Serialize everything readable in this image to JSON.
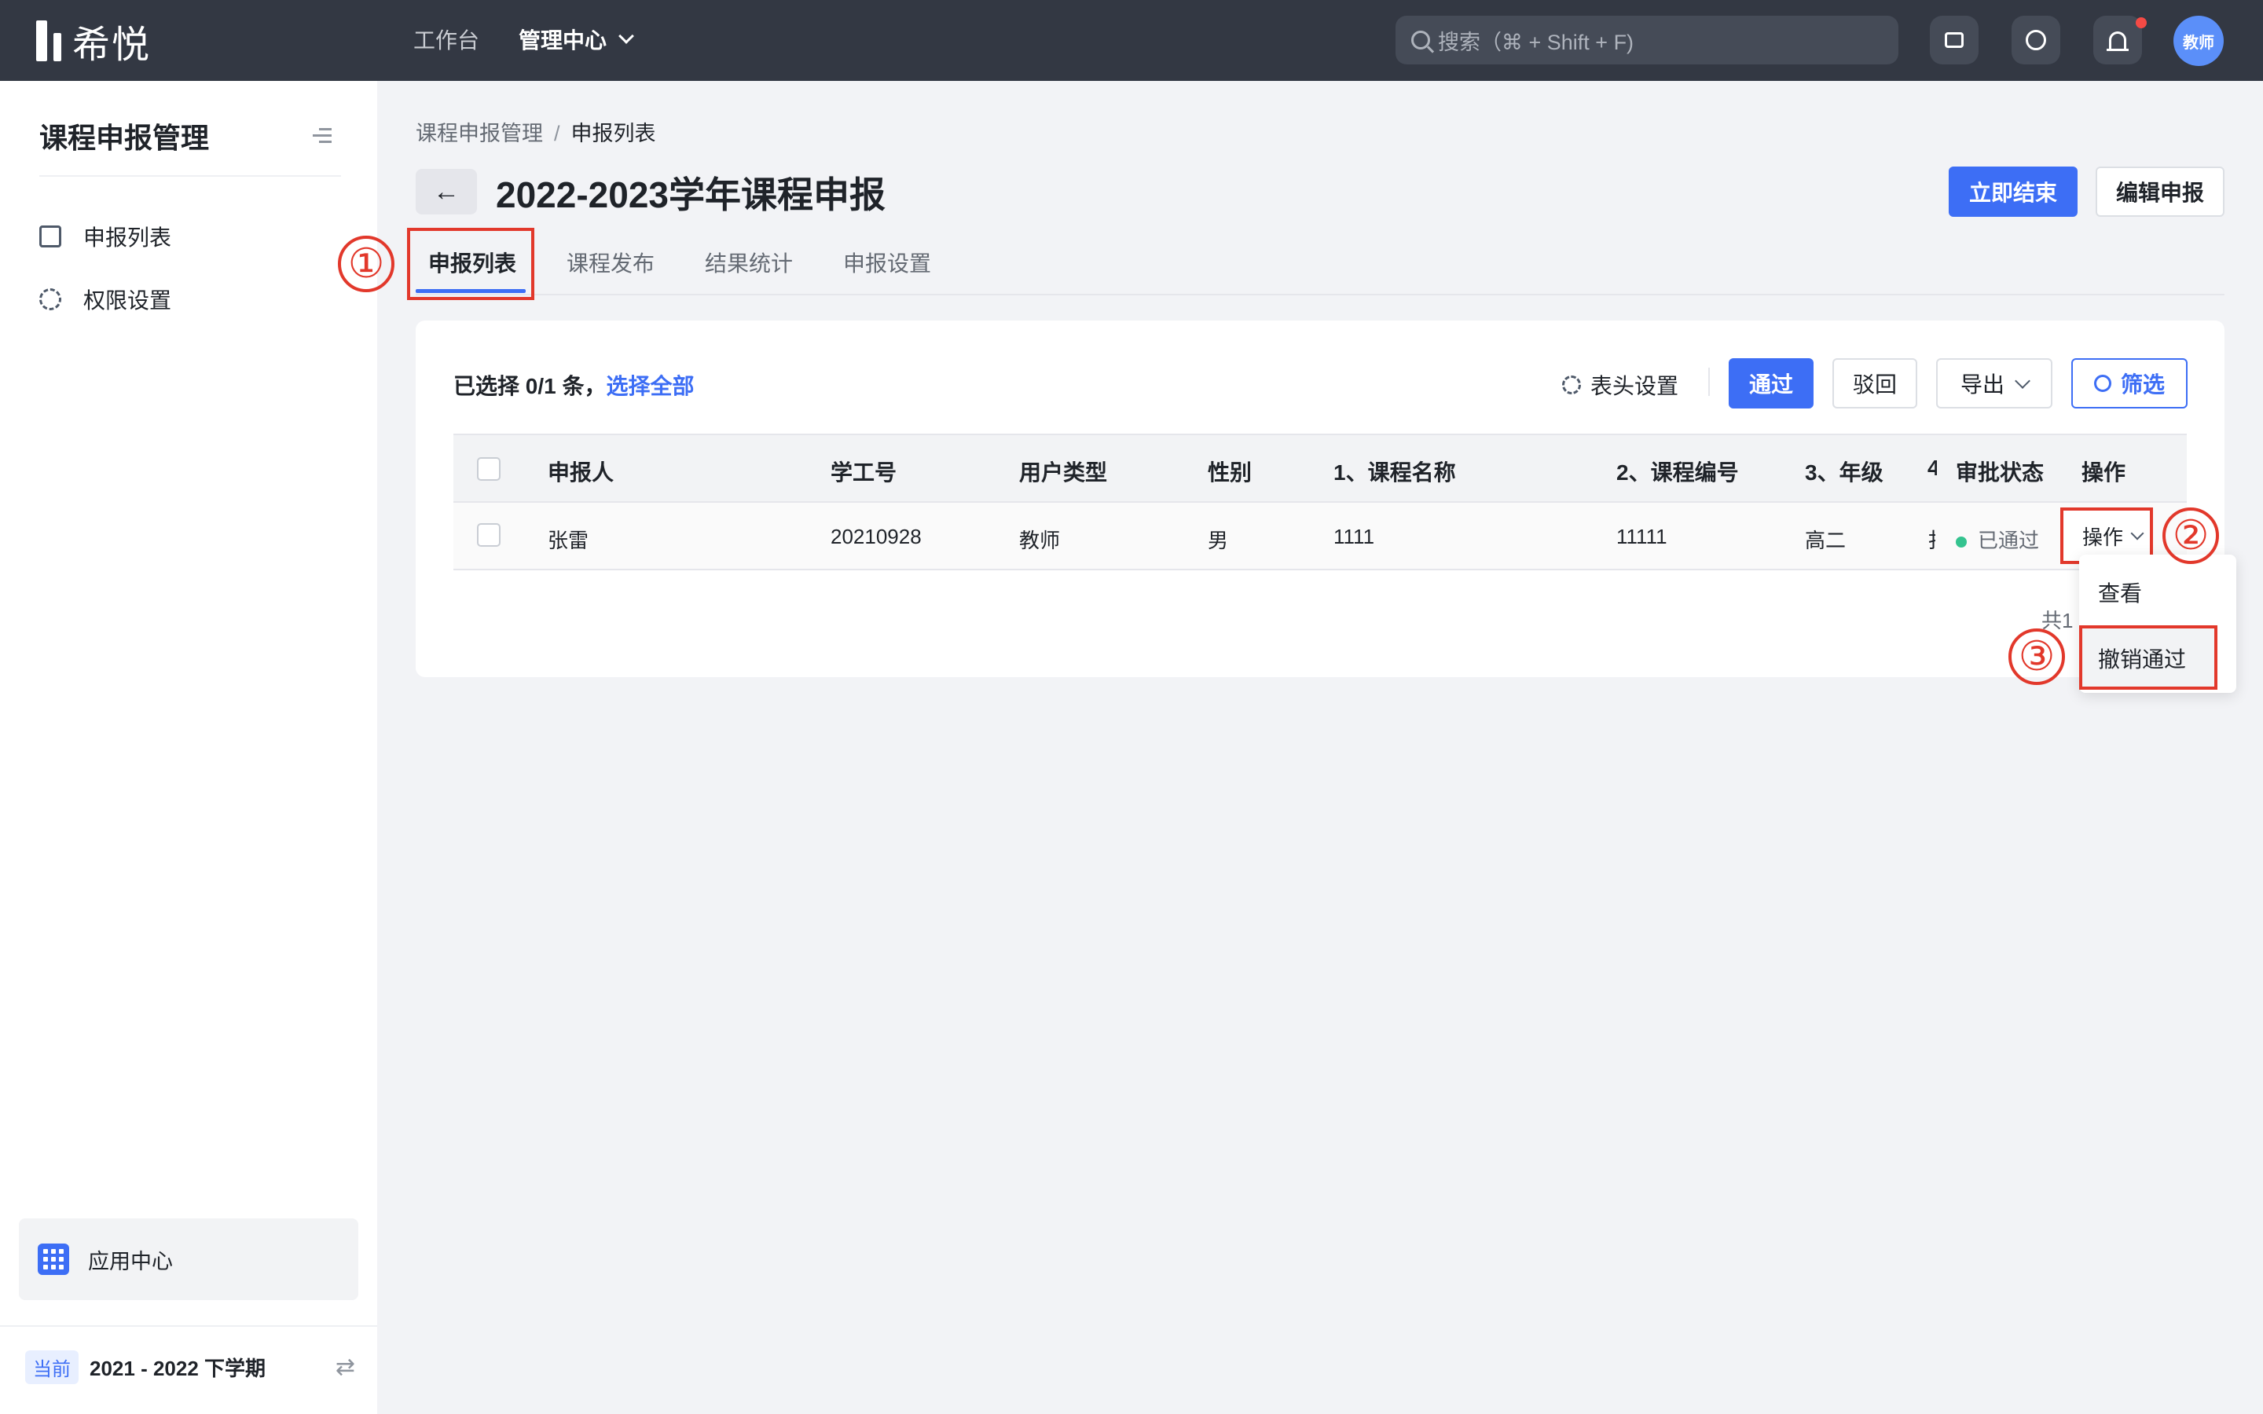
{
  "topbar": {
    "logo_text": "希悦",
    "nav": {
      "workbench": "工作台",
      "admin_center": "管理中心"
    },
    "search_placeholder": "搜索（⌘ + Shift + F)",
    "avatar_text": "教师"
  },
  "sidebar": {
    "title": "课程申报管理",
    "items": [
      {
        "label": "申报列表",
        "icon": "document-icon"
      },
      {
        "label": "权限设置",
        "icon": "gear-icon"
      }
    ],
    "app_center": "应用中心",
    "term_tag": "当前",
    "term": "2021 - 2022 下学期"
  },
  "breadcrumb": {
    "parent": "课程申报管理",
    "separator": "/",
    "current": "申报列表"
  },
  "page": {
    "title": "2022-2023学年课程申报",
    "btn_end": "立即结束",
    "btn_edit": "编辑申报"
  },
  "tabs": [
    "申报列表",
    "课程发布",
    "结果统计",
    "申报设置"
  ],
  "toolbar": {
    "selected": "已选择 0/1 条，",
    "select_all": "选择全部",
    "column_settings": "表头设置",
    "approve": "通过",
    "reject": "驳回",
    "export": "导出",
    "filter": "筛选"
  },
  "table": {
    "headers": [
      "申报人",
      "学工号",
      "用户类型",
      "性别",
      "1、课程名称",
      "2、课程编号",
      "3、年级",
      "4",
      "审批状态",
      "操作"
    ],
    "rows": [
      {
        "name": "张雷",
        "id": "20210928",
        "type": "教师",
        "gender": "男",
        "course_name": "1111",
        "course_code": "11111",
        "grade": "高二",
        "col4": "扌",
        "status": "已通过",
        "action": "操作"
      }
    ]
  },
  "pagination": {
    "total": "共1"
  },
  "dropdown": {
    "view": "查看",
    "revoke": "撤销通过"
  },
  "annotations": [
    "①",
    "②",
    "③"
  ],
  "colors": {
    "primary": "#3d6ef5",
    "topbar": "#333843",
    "annotation": "#e2382b",
    "status_ok": "#34c38f"
  }
}
